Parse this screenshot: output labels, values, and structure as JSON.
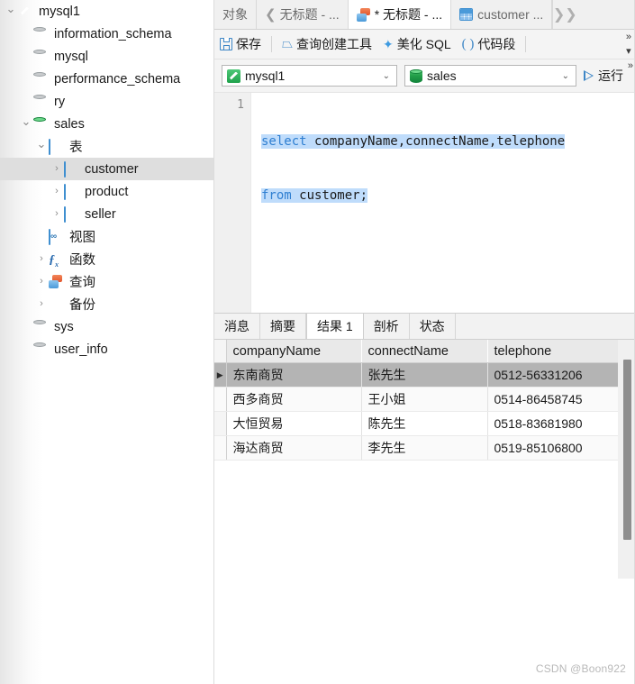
{
  "sidebar": {
    "items": [
      {
        "label": "mysql1",
        "indent": 0,
        "twisty": "down",
        "icon": "mysql-connection-icon",
        "selected": false
      },
      {
        "label": "information_schema",
        "indent": 1,
        "twisty": "none",
        "icon": "database-icon",
        "selected": false
      },
      {
        "label": "mysql",
        "indent": 1,
        "twisty": "none",
        "icon": "database-icon",
        "selected": false
      },
      {
        "label": "performance_schema",
        "indent": 1,
        "twisty": "none",
        "icon": "database-icon",
        "selected": false
      },
      {
        "label": "ry",
        "indent": 1,
        "twisty": "none",
        "icon": "database-icon",
        "selected": false
      },
      {
        "label": "sales",
        "indent": 1,
        "twisty": "down",
        "icon": "database-active-icon",
        "selected": false
      },
      {
        "label": "表",
        "indent": 2,
        "twisty": "down",
        "icon": "table-folder-icon",
        "selected": false
      },
      {
        "label": "customer",
        "indent": 3,
        "twisty": "right",
        "icon": "table-icon",
        "selected": true
      },
      {
        "label": "product",
        "indent": 3,
        "twisty": "right",
        "icon": "table-icon",
        "selected": false
      },
      {
        "label": "seller",
        "indent": 3,
        "twisty": "right",
        "icon": "table-icon",
        "selected": false
      },
      {
        "label": "视图",
        "indent": 2,
        "twisty": "none",
        "icon": "view-icon",
        "selected": false
      },
      {
        "label": "函数",
        "indent": 2,
        "twisty": "right",
        "icon": "function-icon",
        "selected": false
      },
      {
        "label": "查询",
        "indent": 2,
        "twisty": "right",
        "icon": "query-icon",
        "selected": false
      },
      {
        "label": "备份",
        "indent": 2,
        "twisty": "right",
        "icon": "backup-icon",
        "selected": false
      },
      {
        "label": "sys",
        "indent": 1,
        "twisty": "none",
        "icon": "database-icon",
        "selected": false
      },
      {
        "label": "user_info",
        "indent": 1,
        "twisty": "none",
        "icon": "database-icon",
        "selected": false
      }
    ]
  },
  "tabstrip": {
    "object_tab": "对象",
    "prev_chevron": "chevron-left",
    "next_chevron": "chevron-right",
    "tabs": [
      {
        "label": "无标题 - ...",
        "icon": "none",
        "active": false,
        "modified": false
      },
      {
        "label": "* 无标题 - ...",
        "icon": "query-icon",
        "active": true,
        "modified": true
      },
      {
        "label": "customer ...",
        "icon": "table-icon",
        "active": false,
        "modified": false
      }
    ]
  },
  "toolbar": {
    "save_label": "保存",
    "query_builder_label": "查询创建工具",
    "beautify_sql_label": "美化 SQL",
    "snippet_label": "代码段",
    "overflow_label": "»",
    "overflow_caret": "▾"
  },
  "selectors": {
    "connection": "mysql1",
    "database": "sales",
    "run_label": "运行",
    "overflow_label": "»",
    "dropdown_caret": "⌄"
  },
  "editor": {
    "line_number": "1",
    "line1_keyword": "select",
    "line1_rest": " companyName,connectName,telephone",
    "line2_keyword": "from",
    "line2_rest": " customer;"
  },
  "result_tabs": {
    "tabs": [
      {
        "label": "消息",
        "active": false
      },
      {
        "label": "摘要",
        "active": false
      },
      {
        "label": "结果 1",
        "active": true
      },
      {
        "label": "剖析",
        "active": false
      },
      {
        "label": "状态",
        "active": false
      }
    ]
  },
  "grid": {
    "columns": [
      "companyName",
      "connectName",
      "telephone"
    ],
    "rows": [
      {
        "marker": "▶",
        "cells": [
          "东南商贸",
          "张先生",
          "0512-56331206"
        ],
        "selected": true
      },
      {
        "marker": "",
        "cells": [
          "西多商贸",
          "王小姐",
          "0514-86458745"
        ],
        "selected": false
      },
      {
        "marker": "",
        "cells": [
          "大恒贸易",
          "陈先生",
          "0518-83681980"
        ],
        "selected": false
      },
      {
        "marker": "",
        "cells": [
          "海达商贸",
          "李先生",
          "0519-85106800"
        ],
        "selected": false
      }
    ]
  },
  "watermark": {
    "text": "CSDN @Boon922"
  },
  "colors": {
    "accent_blue": "#3d86c6",
    "keyword_blue": "#2f7fd1",
    "selection_blue": "#bfdcfb",
    "row_selected_gray": "#b4b4b4",
    "tree_selected_gray": "#dedede",
    "header_gray": "#e9e9e9",
    "green": "#1ea14a"
  }
}
